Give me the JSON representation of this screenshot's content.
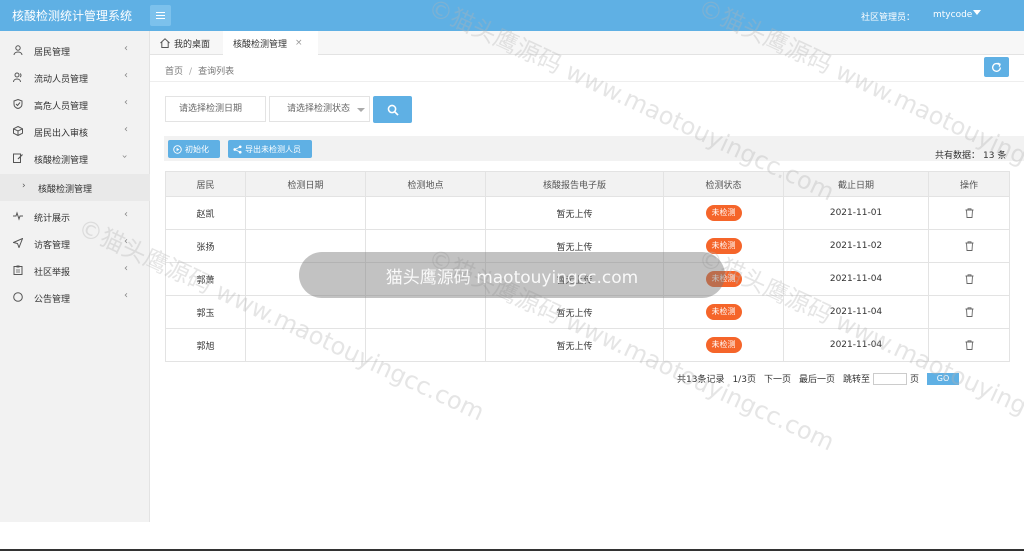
{
  "app": {
    "title": "核酸检测统计管理系统",
    "user_role": "社区管理员：",
    "user_name": "mtycode"
  },
  "sidebar": {
    "items": [
      {
        "label": "居民管理",
        "icon": "user-icon"
      },
      {
        "label": "流动人员管理",
        "icon": "users-icon"
      },
      {
        "label": "高危人员管理",
        "icon": "shield-icon"
      },
      {
        "label": "居民出入审核",
        "icon": "box-icon"
      },
      {
        "label": "核酸检测管理",
        "icon": "edit-icon",
        "expanded": true
      },
      {
        "label": "统计展示",
        "icon": "pulse-icon"
      },
      {
        "label": "访客管理",
        "icon": "send-icon"
      },
      {
        "label": "社区举报",
        "icon": "clipboard-icon"
      },
      {
        "label": "公告管理",
        "icon": "circle-icon"
      }
    ],
    "sub_item": "核酸检测管理"
  },
  "tabs": {
    "home": "我的桌面",
    "active": "核酸检测管理",
    "close": "×"
  },
  "breadcrumb": {
    "home": "首页",
    "sep": "/",
    "current": "查询列表"
  },
  "filter": {
    "date_placeholder": "请选择检测日期",
    "status_placeholder": "请选择检测状态"
  },
  "toolbar": {
    "init_label": "初始化",
    "export_label": "导出未检测人员",
    "total_label": "共有数据：",
    "total_count": "13",
    "total_unit": "条"
  },
  "table": {
    "columns": [
      "居民",
      "检测日期",
      "检测地点",
      "核酸报告电子版",
      "检测状态",
      "截止日期",
      "操作"
    ],
    "rows": [
      {
        "resident": "赵凯",
        "test_date": "",
        "location": "",
        "report": "暂无上传",
        "status": "未检测",
        "deadline": "2021-11-01"
      },
      {
        "resident": "张扬",
        "test_date": "",
        "location": "",
        "report": "暂无上传",
        "status": "未检测",
        "deadline": "2021-11-02"
      },
      {
        "resident": "郭萧",
        "test_date": "",
        "location": "",
        "report": "暂无上传",
        "status": "未检测",
        "deadline": "2021-11-04"
      },
      {
        "resident": "郭玉",
        "test_date": "",
        "location": "",
        "report": "暂无上传",
        "status": "未检测",
        "deadline": "2021-11-04"
      },
      {
        "resident": "郭旭",
        "test_date": "",
        "location": "",
        "report": "暂无上传",
        "status": "未检测",
        "deadline": "2021-11-04"
      }
    ]
  },
  "pager": {
    "records": "共13条记录",
    "page": "1/3页",
    "next": "下一页",
    "last": "最后一页",
    "jump_label": "跳转至",
    "page_unit": "页",
    "go": "GO"
  },
  "watermark": {
    "toast": "猫头鹰源码 maotouyingcc.com",
    "text": "©猫头鹰源码 www.maotouyingcc.com"
  },
  "colors": {
    "primary": "#5fb0e4",
    "status_badge": "#f5652a",
    "sidebar_bg": "#f2f2f2"
  }
}
